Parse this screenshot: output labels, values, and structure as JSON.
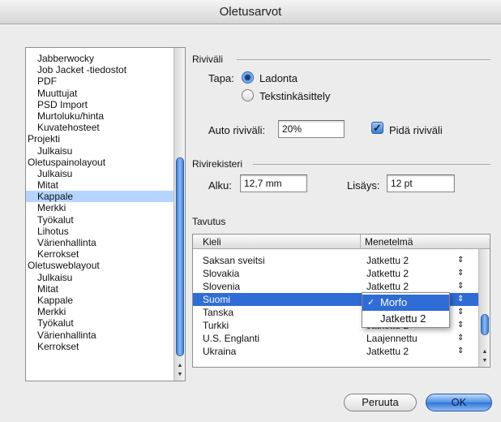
{
  "window": {
    "title": "Oletusarvot"
  },
  "categories": {
    "items": [
      {
        "label": "Jabberwocky",
        "group": false,
        "selected": false
      },
      {
        "label": "Job Jacket -tiedostot",
        "group": false,
        "selected": false
      },
      {
        "label": "PDF",
        "group": false,
        "selected": false
      },
      {
        "label": "Muuttujat",
        "group": false,
        "selected": false
      },
      {
        "label": "PSD Import",
        "group": false,
        "selected": false
      },
      {
        "label": "Murtoluku/hinta",
        "group": false,
        "selected": false
      },
      {
        "label": "Kuvatehosteet",
        "group": false,
        "selected": false
      },
      {
        "label": "Projekti",
        "group": true,
        "selected": false
      },
      {
        "label": "Julkaisu",
        "group": false,
        "selected": false
      },
      {
        "label": "Oletuspainolayout",
        "group": true,
        "selected": false
      },
      {
        "label": "Julkaisu",
        "group": false,
        "selected": false
      },
      {
        "label": "Mitat",
        "group": false,
        "selected": false
      },
      {
        "label": "Kappale",
        "group": false,
        "selected": true
      },
      {
        "label": "Merkki",
        "group": false,
        "selected": false
      },
      {
        "label": "Työkalut",
        "group": false,
        "selected": false
      },
      {
        "label": "Lihotus",
        "group": false,
        "selected": false
      },
      {
        "label": "Värienhallinta",
        "group": false,
        "selected": false
      },
      {
        "label": "Kerrokset",
        "group": false,
        "selected": false
      },
      {
        "label": "Oletusweblayout",
        "group": true,
        "selected": false
      },
      {
        "label": "Julkaisu",
        "group": false,
        "selected": false
      },
      {
        "label": "Mitat",
        "group": false,
        "selected": false
      },
      {
        "label": "Kappale",
        "group": false,
        "selected": false
      },
      {
        "label": "Merkki",
        "group": false,
        "selected": false
      },
      {
        "label": "Työkalut",
        "group": false,
        "selected": false
      },
      {
        "label": "Värienhallinta",
        "group": false,
        "selected": false
      },
      {
        "label": "Kerrokset",
        "group": false,
        "selected": false
      }
    ]
  },
  "rivivali": {
    "heading": "Riviväli",
    "tapa_label": "Tapa:",
    "options": [
      {
        "label": "Ladonta",
        "selected": true
      },
      {
        "label": "Tekstinkäsittely",
        "selected": false
      }
    ],
    "auto_label": "Auto riviväli:",
    "auto_value": "20%",
    "keep_label": "Pidä riviväli",
    "keep_checked": true
  },
  "rivirekisteri": {
    "heading": "Rivirekisteri",
    "alku_label": "Alku:",
    "alku_value": "12,7 mm",
    "lisays_label": "Lisäys:",
    "lisays_value": "12 pt"
  },
  "tavutus": {
    "heading": "Tavutus",
    "columns": {
      "language": "Kieli",
      "method": "Menetelmä"
    },
    "rows": [
      {
        "language": "Saksan sveitsi",
        "method": "Jatkettu 2",
        "selected": false
      },
      {
        "language": "Slovakia",
        "method": "Jatkettu 2",
        "selected": false
      },
      {
        "language": "Slovenia",
        "method": "Jatkettu 2",
        "selected": false
      },
      {
        "language": "Suomi",
        "method": "Morfo",
        "selected": true
      },
      {
        "language": "Tanska",
        "method": "Jatkettu 2",
        "selected": false
      },
      {
        "language": "Turkki",
        "method": "Jatkettu 2",
        "selected": false
      },
      {
        "language": "U.S. Englanti",
        "method": "Laajennettu",
        "selected": false
      },
      {
        "language": "Ukraina",
        "method": "Jatkettu 2",
        "selected": false
      }
    ],
    "popup": {
      "options": [
        {
          "label": "Morfo",
          "checked": true
        },
        {
          "label": "Jatkettu 2",
          "checked": false
        }
      ],
      "check_glyph": "✓"
    },
    "stepper_glyph": "⇕"
  },
  "buttons": {
    "cancel": "Peruuta",
    "ok": "OK"
  },
  "colors": {
    "selection": "#2f6cd6",
    "list_selection": "#b5d5ff"
  }
}
